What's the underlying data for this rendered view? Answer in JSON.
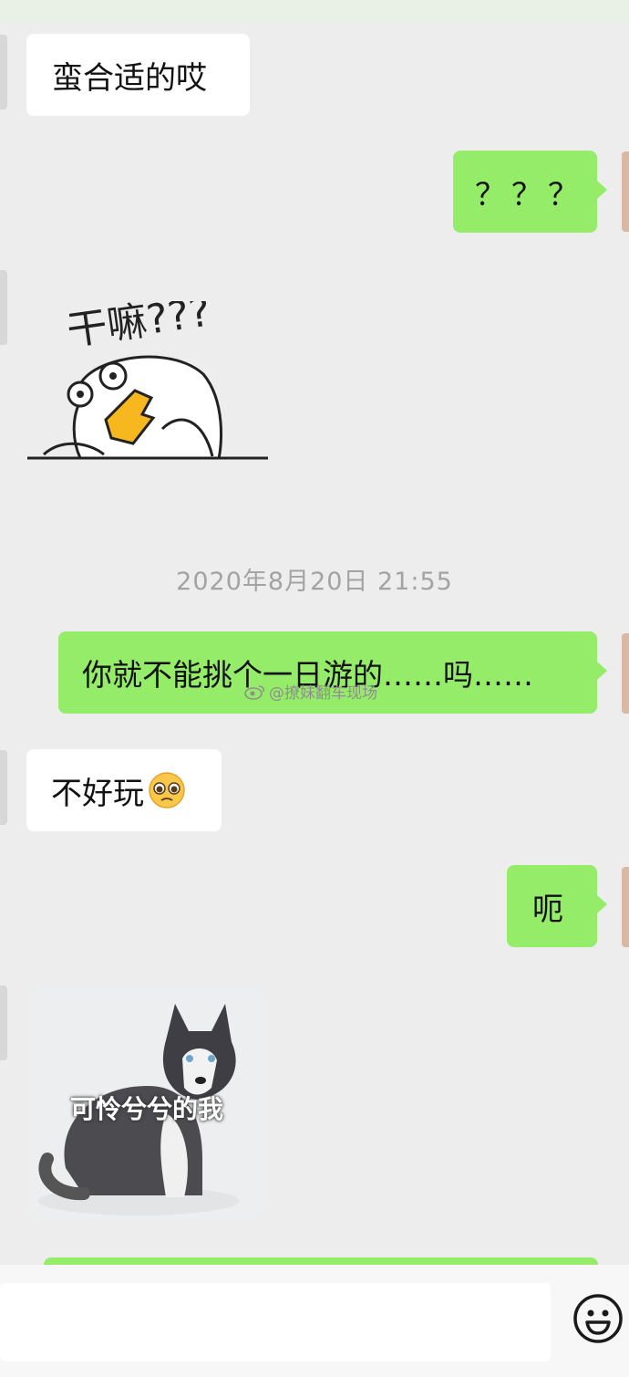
{
  "chat": {
    "messages": [
      {
        "side": "in",
        "text": "蛮合适的哎"
      },
      {
        "side": "out",
        "text": "？？？"
      },
      {
        "side": "in",
        "sticker": "duck-sticker",
        "text": "干嘛???"
      },
      {
        "timestamp": "2020年8月20日 21:55"
      },
      {
        "side": "out",
        "text": "你就不能挑个一日游的……吗……"
      },
      {
        "side": "in",
        "text": "不好玩",
        "emoji": "pleading-face-emoji"
      },
      {
        "side": "out",
        "text": "呃"
      },
      {
        "side": "in",
        "sticker": "husky-sticker",
        "text": "可怜兮兮的我"
      }
    ]
  },
  "watermark": {
    "text": "@撩妹翻车现场",
    "icon": "weibo-icon"
  },
  "input_bar": {
    "emoji_icon": "smiley-icon"
  },
  "colors": {
    "background": "#ededed",
    "outgoing": "#95ec69",
    "incoming": "#ffffff"
  }
}
